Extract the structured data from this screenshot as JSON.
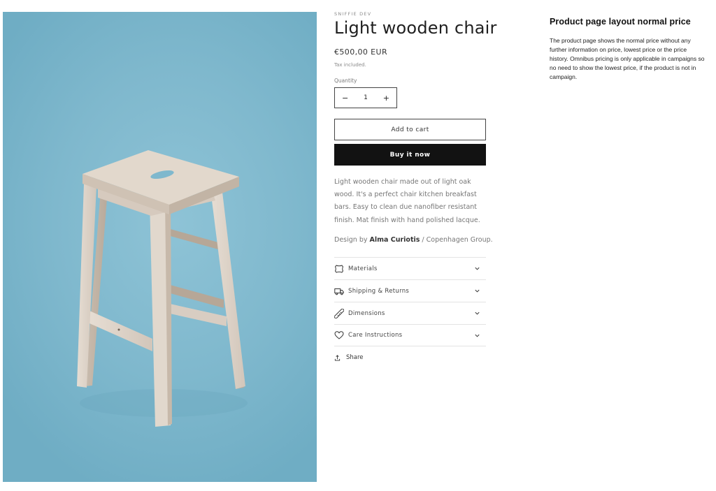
{
  "product": {
    "vendor": "SNIFFIE DEV",
    "title": "Light wooden chair",
    "price": "€500,00 EUR",
    "tax_note": "Tax included.",
    "image_alt": "Light wooden bar stool on a blue background"
  },
  "quantity": {
    "label": "Quantity",
    "value": "1",
    "decrement": "−",
    "increment": "+"
  },
  "buttons": {
    "add_to_cart": "Add to cart",
    "buy_now": "Buy it now"
  },
  "description": "Light wooden chair made out of light oak wood. It's a perfect chair kitchen breakfast bars. Easy to clean due nanofiber resistant finish. Mat finish with hand polished lacque.",
  "designer": {
    "prefix": "Design by",
    "name": "Alma Curiotis",
    "suffix": " / Copenhagen Group."
  },
  "accordion": [
    {
      "label": "Materials",
      "icon": "leather-icon"
    },
    {
      "label": "Shipping & Returns",
      "icon": "truck-icon"
    },
    {
      "label": "Dimensions",
      "icon": "ruler-icon"
    },
    {
      "label": "Care Instructions",
      "icon": "heart-icon"
    }
  ],
  "share": {
    "label": "Share",
    "icon": "share-icon"
  },
  "note": {
    "title": "Product page layout normal price",
    "body": "The product page shows the normal price without any further information on price, lowest price or the price history. Omnibus pricing is only applicable in campaigns so no need to show the lowest price, if the product is not in campaign."
  },
  "colors": {
    "image_background": "#7fb8cd",
    "buy_button": "#121212"
  }
}
